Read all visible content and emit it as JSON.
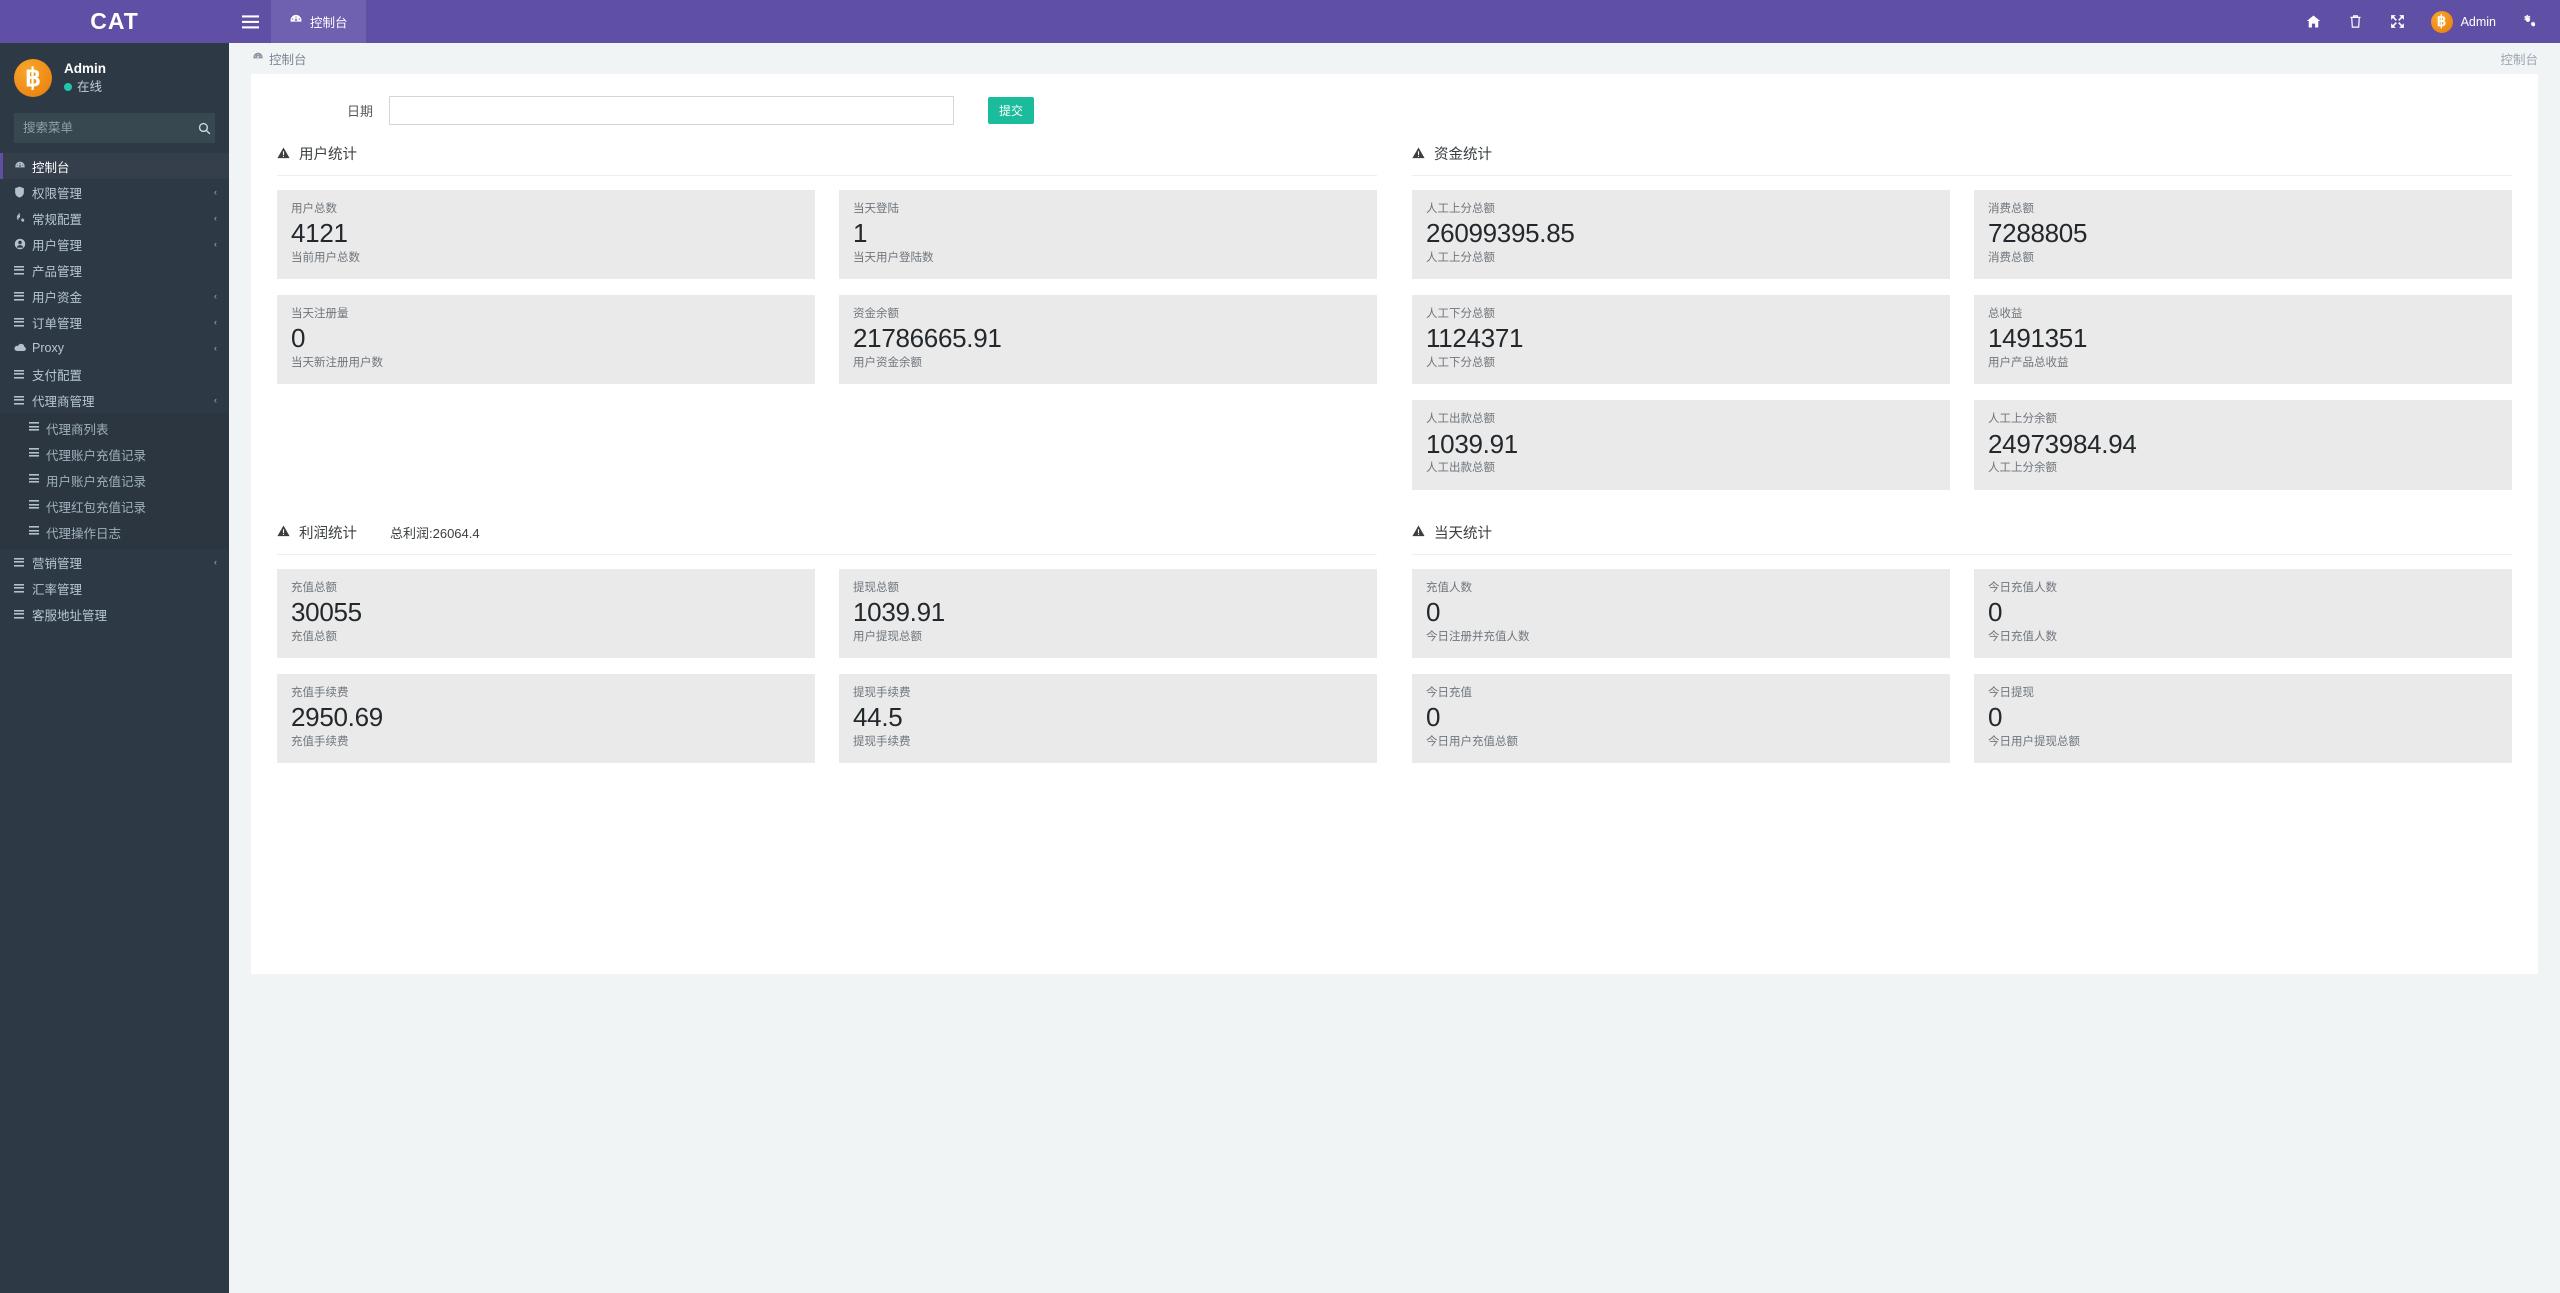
{
  "sidebar": {
    "logo": "CAT",
    "user": {
      "name": "Admin",
      "status": "在线",
      "avatar_glyph": "฿"
    },
    "search": {
      "placeholder": "搜索菜单",
      "value": "",
      "icon": "search-icon"
    },
    "menu": [
      {
        "label": "控制台",
        "icon": "dashboard-icon",
        "active": true,
        "arrow": ""
      },
      {
        "label": "权限管理",
        "icon": "shield-icon",
        "active": false,
        "arrow": "‹"
      },
      {
        "label": "常规配置",
        "icon": "gears-icon",
        "active": false,
        "arrow": "‹"
      },
      {
        "label": "用户管理",
        "icon": "user-circle-icon",
        "active": false,
        "arrow": "‹"
      },
      {
        "label": "产品管理",
        "icon": "list-icon",
        "active": false,
        "arrow": ""
      },
      {
        "label": "用户资金",
        "icon": "list-icon",
        "active": false,
        "arrow": "‹"
      },
      {
        "label": "订单管理",
        "icon": "list-icon",
        "active": false,
        "arrow": "‹"
      },
      {
        "label": "Proxy",
        "icon": "cloud-icon",
        "active": false,
        "arrow": "‹"
      },
      {
        "label": "支付配置",
        "icon": "list-icon",
        "active": false,
        "arrow": ""
      },
      {
        "label": "代理商管理",
        "icon": "list-icon",
        "active": false,
        "arrow": "‹",
        "expanded": true
      }
    ],
    "submenu": [
      {
        "label": "代理商列表",
        "icon": "list-icon"
      },
      {
        "label": "代理账户充值记录",
        "icon": "list-icon"
      },
      {
        "label": "用户账户充值记录",
        "icon": "list-icon"
      },
      {
        "label": "代理红包充值记录",
        "icon": "list-icon"
      },
      {
        "label": "代理操作日志",
        "icon": "list-icon"
      }
    ],
    "menu_after": [
      {
        "label": "营销管理",
        "icon": "list-icon",
        "arrow": "‹"
      },
      {
        "label": "汇率管理",
        "icon": "list-icon",
        "arrow": ""
      },
      {
        "label": "客服地址管理",
        "icon": "list-icon",
        "arrow": ""
      }
    ]
  },
  "topnav": {
    "hamburger": "menu-icon",
    "tab": {
      "label": "控制台",
      "icon": "dashboard-icon"
    },
    "icons": [
      {
        "name": "home-icon",
        "glyph": "⌂"
      },
      {
        "name": "trash-icon",
        "glyph": "🗑"
      },
      {
        "name": "fullscreen-icon",
        "glyph": "⤢"
      }
    ],
    "user": {
      "name": "Admin",
      "avatar_glyph": "฿"
    },
    "settings_icon": "gear-icon"
  },
  "breadcrumb": {
    "icon": "dashboard-icon",
    "current": "控制台",
    "right": "控制台"
  },
  "filter": {
    "label": "日期",
    "date_value": "",
    "date_placeholder": "",
    "submit_label": "提交"
  },
  "panels": [
    {
      "key": "user_stats",
      "title": "用户统计",
      "subtitle": "",
      "cards": [
        {
          "label": "用户总数",
          "value": "4121",
          "desc": "当前用户总数"
        },
        {
          "label": "当天登陆",
          "value": "1",
          "desc": "当天用户登陆数"
        },
        {
          "label": "当天注册量",
          "value": "0",
          "desc": "当天新注册用户数"
        },
        {
          "label": "资金余额",
          "value": "21786665.91",
          "desc": "用户资金余额"
        }
      ]
    },
    {
      "key": "fund_stats",
      "title": "资金统计",
      "subtitle": "",
      "cards": [
        {
          "label": "人工上分总额",
          "value": "26099395.85",
          "desc": "人工上分总额"
        },
        {
          "label": "消费总额",
          "value": "7288805",
          "desc": "消费总额"
        },
        {
          "label": "人工下分总额",
          "value": "1124371",
          "desc": "人工下分总额"
        },
        {
          "label": "总收益",
          "value": "1491351",
          "desc": "用户产品总收益"
        },
        {
          "label": "人工出款总额",
          "value": "1039.91",
          "desc": "人工出款总额"
        },
        {
          "label": "人工上分余额",
          "value": "24973984.94",
          "desc": "人工上分余额"
        }
      ]
    },
    {
      "key": "profit_stats",
      "title": "利润统计",
      "subtitle": "总利润:26064.4",
      "cards": [
        {
          "label": "充值总额",
          "value": "30055",
          "desc": "充值总额"
        },
        {
          "label": "提现总额",
          "value": "1039.91",
          "desc": "用户提现总额"
        },
        {
          "label": "充值手续费",
          "value": "2950.69",
          "desc": "充值手续费"
        },
        {
          "label": "提现手续费",
          "value": "44.5",
          "desc": "提现手续费"
        }
      ]
    },
    {
      "key": "today_stats",
      "title": "当天统计",
      "subtitle": "",
      "cards": [
        {
          "label": "充值人数",
          "value": "0",
          "desc": "今日注册并充值人数"
        },
        {
          "label": "今日充值人数",
          "value": "0",
          "desc": "今日充值人数"
        },
        {
          "label": "今日充值",
          "value": "0",
          "desc": "今日用户充值总额"
        },
        {
          "label": "今日提现",
          "value": "0",
          "desc": "今日用户提现总额"
        }
      ]
    }
  ],
  "colors": {
    "brand_purple": "#6050a5",
    "sidebar_dark": "#2d3a46",
    "accent_green": "#1abc9c",
    "online_green": "#22c6ab",
    "bitcoin_orange": "#f08c18"
  }
}
